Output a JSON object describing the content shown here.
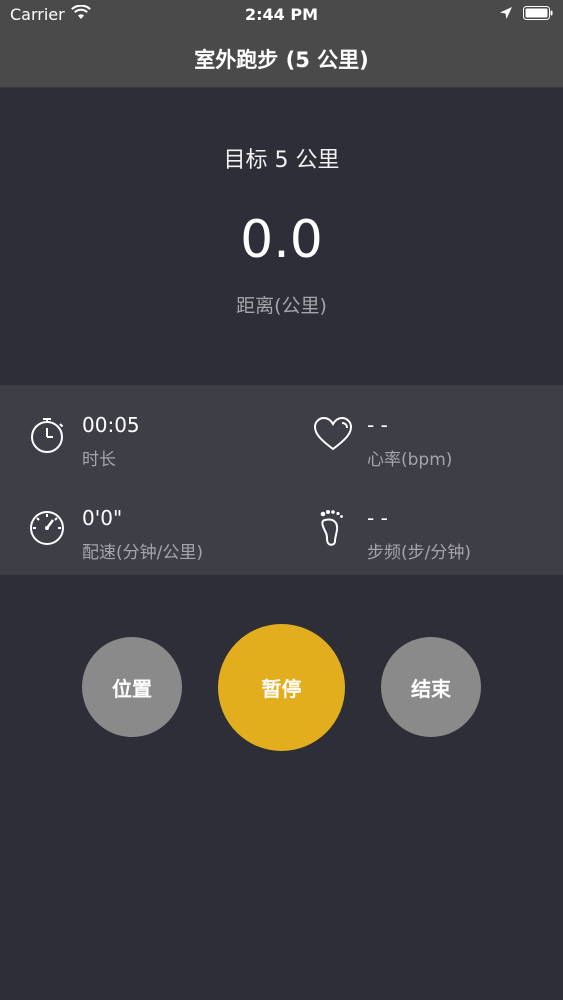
{
  "status_bar": {
    "carrier": "Carrier",
    "time": "2:44 PM"
  },
  "nav": {
    "title": "室外跑步 (5 公里)"
  },
  "goal": {
    "text": "目标 5 公里"
  },
  "distance": {
    "value": "0.0",
    "label": "距离(公里)"
  },
  "stats": {
    "duration": {
      "value": "00:05",
      "label": "时长",
      "icon": "stopwatch-icon"
    },
    "heart_rate": {
      "value": "- -",
      "label": "心率(bpm)",
      "icon": "heart-icon"
    },
    "pace": {
      "value": "0'0\"",
      "label": "配速(分钟/公里)",
      "icon": "speedometer-icon"
    },
    "cadence": {
      "value": "- -",
      "label": "步频(步/分钟)",
      "icon": "footprint-icon"
    }
  },
  "buttons": {
    "location": "位置",
    "pause": "暂停",
    "end": "结束"
  },
  "colors": {
    "background": "#2e2e38",
    "bar": "#4a4a4a",
    "panel": "#3e3e47",
    "accent": "#e3ae1e",
    "secondary_button": "#8a8a8a"
  }
}
